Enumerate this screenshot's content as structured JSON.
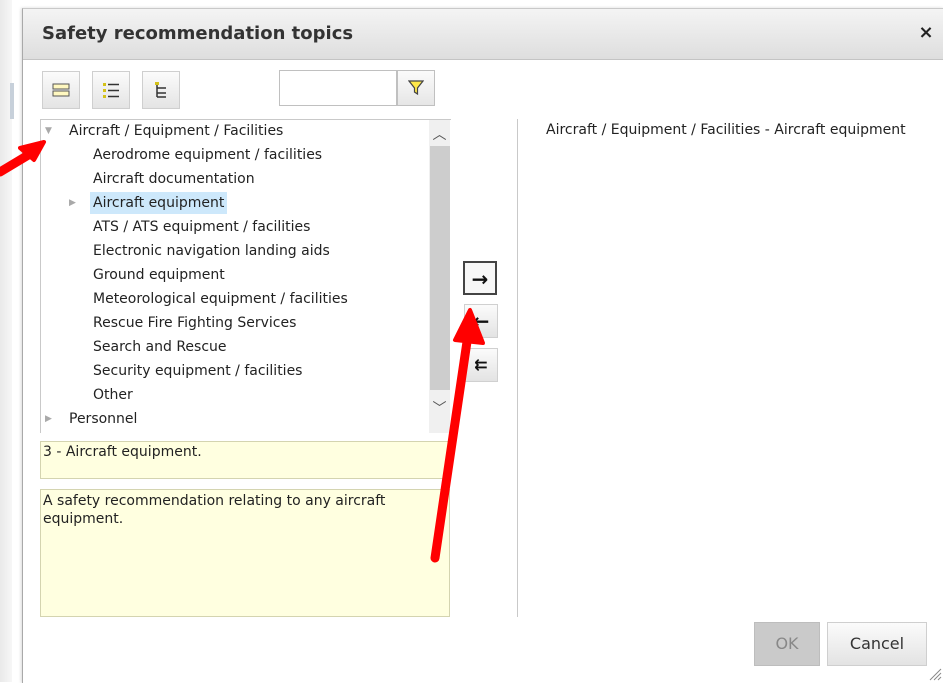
{
  "dialog": {
    "title": "Safety recommendation topics",
    "close_icon": "×"
  },
  "toolbar": {
    "icons": [
      "list-view-icon",
      "expand-all-icon",
      "collapse-tree-icon"
    ],
    "search": {
      "value": "",
      "placeholder": ""
    },
    "filter_icon": "filter-icon"
  },
  "tree": {
    "items": [
      {
        "label": "Aircraft / Equipment / Facilities",
        "expanded": true
      },
      {
        "label": "Aerodrome equipment / facilities"
      },
      {
        "label": "Aircraft documentation"
      },
      {
        "label": "Aircraft equipment",
        "selected": true,
        "has_children": true
      },
      {
        "label": "ATS / ATS equipment / facilities"
      },
      {
        "label": "Electronic navigation landing aids"
      },
      {
        "label": "Ground equipment"
      },
      {
        "label": "Meteorological equipment / facilities"
      },
      {
        "label": "Rescue Fire Fighting Services"
      },
      {
        "label": "Search and Rescue"
      },
      {
        "label": "Security equipment / facilities"
      },
      {
        "label": "Other"
      },
      {
        "label": "Personnel",
        "has_children": true
      }
    ]
  },
  "details": {
    "code": "3 - Aircraft equipment.",
    "description": "A safety recommendation relating to any aircraft equipment."
  },
  "move_buttons": {
    "add": "→",
    "remove": "←",
    "remove_all": "⇇"
  },
  "selected_list": [
    "Aircraft / Equipment / Facilities - Aircraft equipment"
  ],
  "footer": {
    "ok_label": "OK",
    "cancel_label": "Cancel"
  },
  "colors": {
    "selection_highlight": "#cde8fb",
    "detail_background": "#ffffe0",
    "annotation_arrow": "#ff0000"
  }
}
